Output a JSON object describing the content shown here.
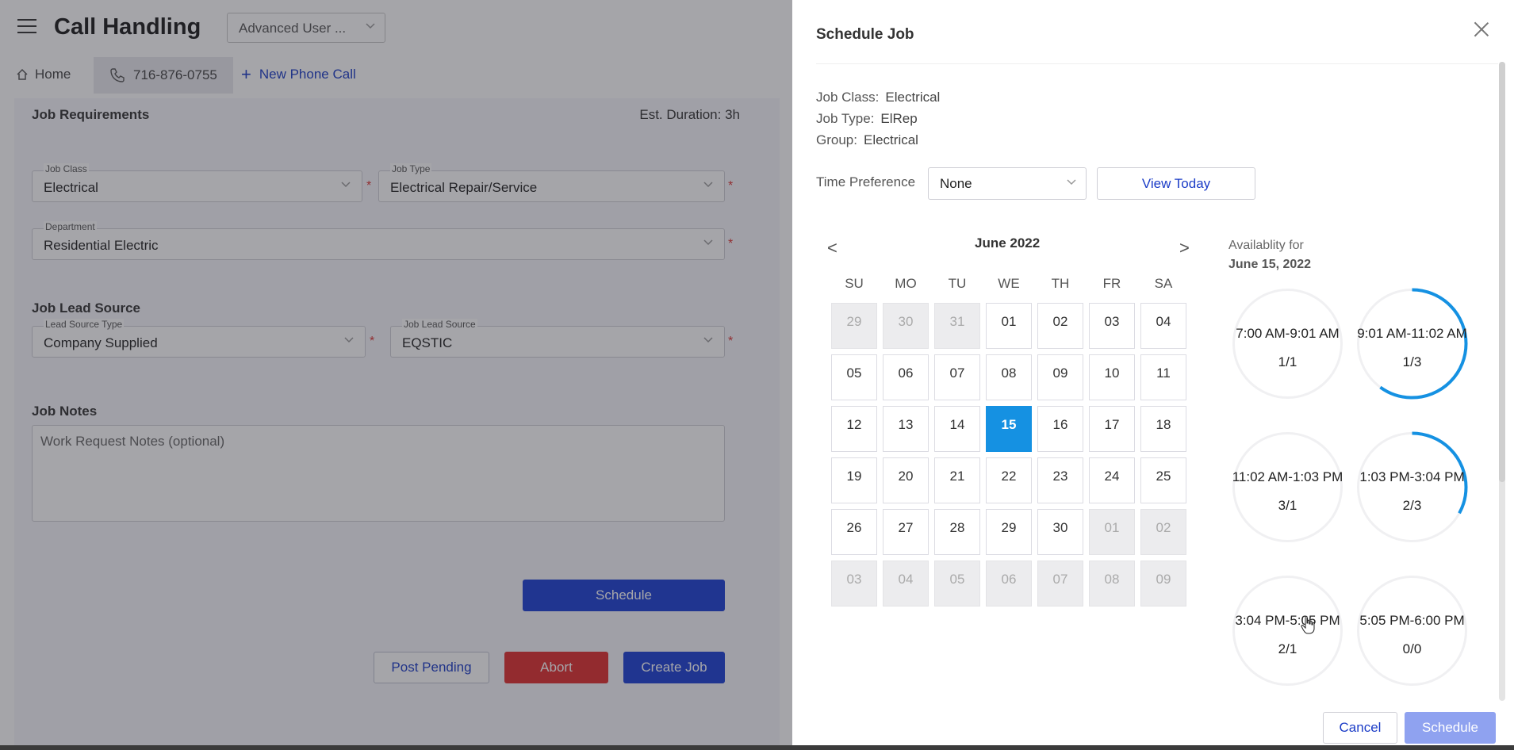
{
  "app": {
    "title": "Call Handling",
    "mode_select": "Advanced User ...",
    "nav": {
      "home": "Home",
      "phone": "716-876-0755",
      "new_call": "New Phone Call"
    }
  },
  "job_requirements": {
    "title": "Job Requirements",
    "est_duration": "Est. Duration: 3h",
    "job_class": {
      "label": "Job Class",
      "value": "Electrical"
    },
    "job_type": {
      "label": "Job Type",
      "value": "Electrical Repair/Service"
    },
    "department": {
      "label": "Department",
      "value": "Residential Electric"
    },
    "required_mark": "*"
  },
  "lead_source": {
    "title": "Job Lead Source",
    "type": {
      "label": "Lead Source Type",
      "value": "Company Supplied"
    },
    "source": {
      "label": "Job Lead Source",
      "value": "EQSTIC"
    }
  },
  "notes": {
    "title": "Job Notes",
    "placeholder": "Work Request Notes (optional)"
  },
  "left_buttons": {
    "schedule": "Schedule",
    "post_pending": "Post Pending",
    "abort": "Abort",
    "create_job": "Create Job"
  },
  "modal": {
    "title": "Schedule Job",
    "job_class_label": "Job Class:",
    "job_class": "Electrical",
    "job_type_label": "Job Type:",
    "job_type": "ElRep",
    "group_label": "Group:",
    "group": "Electrical",
    "time_pref_label": "Time Preference",
    "time_pref_value": "None",
    "view_today": "View Today",
    "calendar": {
      "month": "June 2022",
      "prev": "<",
      "next": ">",
      "dow": [
        "SU",
        "MO",
        "TU",
        "WE",
        "TH",
        "FR",
        "SA"
      ],
      "weeks": [
        [
          "29",
          "30",
          "31",
          "01",
          "02",
          "03",
          "04"
        ],
        [
          "05",
          "06",
          "07",
          "08",
          "09",
          "10",
          "11"
        ],
        [
          "12",
          "13",
          "14",
          "15",
          "16",
          "17",
          "18"
        ],
        [
          "19",
          "20",
          "21",
          "22",
          "23",
          "24",
          "25"
        ],
        [
          "26",
          "27",
          "28",
          "29",
          "30",
          "01",
          "02"
        ],
        [
          "03",
          "04",
          "05",
          "06",
          "07",
          "08",
          "09"
        ]
      ],
      "selected": "15"
    },
    "availability_label": "Availablity for",
    "availability_date": "June 15, 2022",
    "slots": [
      {
        "time": "7:00 AM-9:01 AM",
        "count": "1/1",
        "fill": 0
      },
      {
        "time": "9:01 AM-11:02 AM",
        "count": "1/3",
        "fill": 0.6
      },
      {
        "time": "11:02 AM-1:03 PM",
        "count": "3/1",
        "fill": 0
      },
      {
        "time": "1:03 PM-3:04 PM",
        "count": "2/3",
        "fill": 0.33
      },
      {
        "time": "3:04 PM-5:05 PM",
        "count": "2/1",
        "fill": 0
      },
      {
        "time": "5:05 PM-6:00 PM",
        "count": "0/0",
        "fill": 0
      }
    ],
    "cancel": "Cancel",
    "schedule": "Schedule",
    "colors": {
      "accent": "#1591e2",
      "ring": "#1591e2",
      "primary": "#1a3fd4",
      "danger": "#e12d2d"
    }
  }
}
